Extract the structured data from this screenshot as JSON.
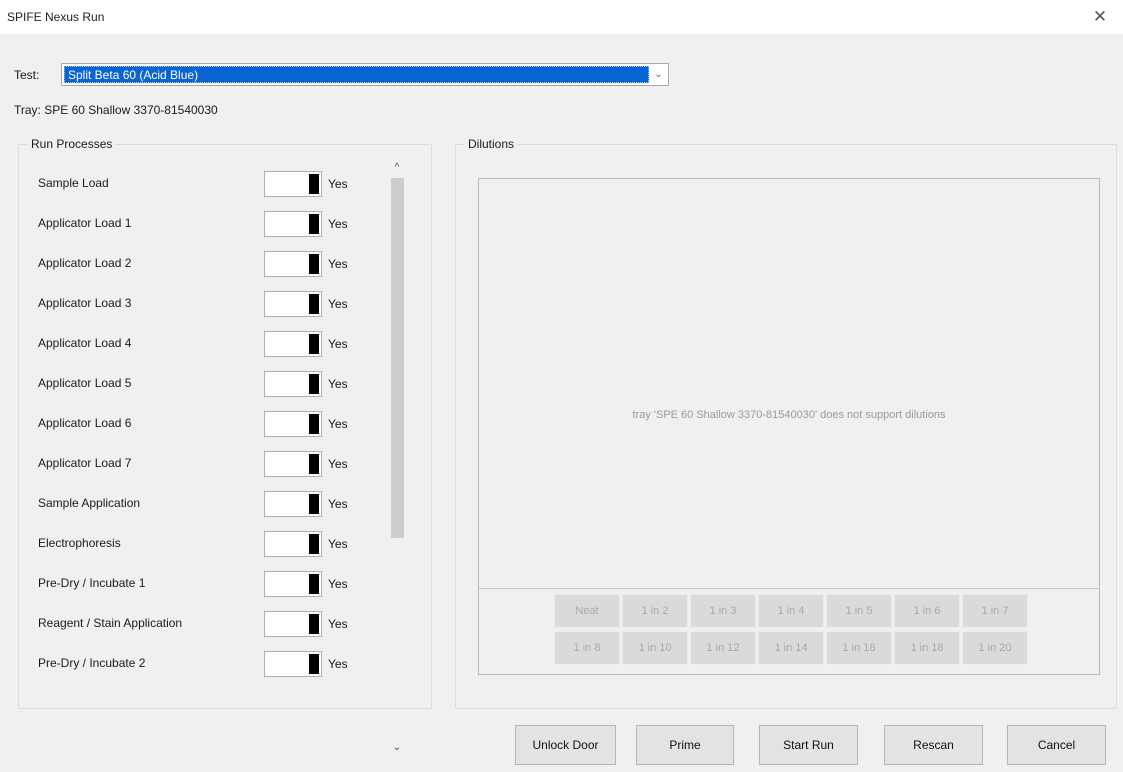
{
  "window": {
    "title": "SPIFE Nexus Run",
    "close_glyph": "✕"
  },
  "test": {
    "label": "Test:",
    "selected": "Split Beta  60 (Acid Blue)"
  },
  "tray": {
    "line": "Tray:  SPE  60 Shallow  3370-81540030"
  },
  "run_processes": {
    "title": "Run Processes",
    "items": [
      {
        "label": "Sample Load",
        "value": "Yes"
      },
      {
        "label": "Applicator Load 1",
        "value": "Yes"
      },
      {
        "label": "Applicator Load 2",
        "value": "Yes"
      },
      {
        "label": "Applicator Load 3",
        "value": "Yes"
      },
      {
        "label": "Applicator Load 4",
        "value": "Yes"
      },
      {
        "label": "Applicator Load 5",
        "value": "Yes"
      },
      {
        "label": "Applicator Load 6",
        "value": "Yes"
      },
      {
        "label": "Applicator Load 7",
        "value": "Yes"
      },
      {
        "label": "Sample Application",
        "value": "Yes"
      },
      {
        "label": "Electrophoresis",
        "value": "Yes"
      },
      {
        "label": "Pre-Dry / Incubate 1",
        "value": "Yes"
      },
      {
        "label": "Reagent / Stain Application",
        "value": "Yes"
      },
      {
        "label": "Pre-Dry / Incubate 2",
        "value": "Yes"
      }
    ]
  },
  "dilutions": {
    "title": "Dilutions",
    "message": "tray 'SPE  60 Shallow  3370-81540030' does not support dilutions",
    "row1": [
      "Neat",
      "1 in 2",
      "1 in 3",
      "1 in 4",
      "1 in 5",
      "1 in 6",
      "1 in 7"
    ],
    "row2": [
      "1 in 8",
      "1 in 10",
      "1 in 12",
      "1 in 14",
      "1 in 16",
      "1 in 18",
      "1 in 20"
    ]
  },
  "buttons": {
    "unlock_door": "Unlock Door",
    "prime": "Prime",
    "start_run": "Start Run",
    "rescan": "Rescan",
    "cancel": "Cancel"
  },
  "colors": {
    "selection": "#0a64d2",
    "window_bg": "#f0f0f0"
  },
  "icons": {
    "dropdown": "chevron-down-icon",
    "close": "close-icon"
  }
}
